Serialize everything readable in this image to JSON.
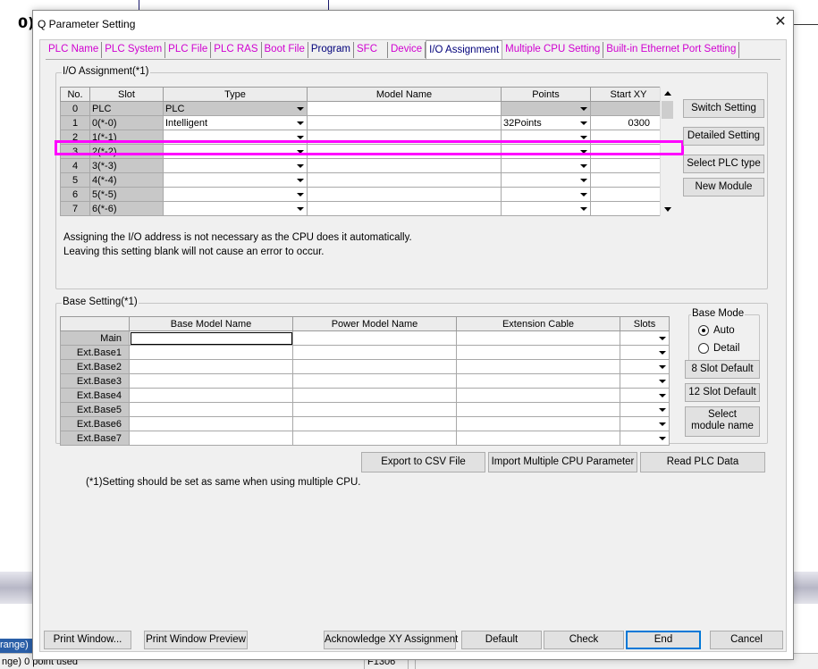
{
  "background": {
    "fragment_left": "0)",
    "blue_tab_text": "range)",
    "status_left": "nge) 0 point used",
    "status_mid": "F1306"
  },
  "dialog": {
    "title": "Q Parameter Setting",
    "close_glyph": "✕"
  },
  "tabs": [
    {
      "label": "PLC Name"
    },
    {
      "label": "PLC System"
    },
    {
      "label": "PLC File"
    },
    {
      "label": "PLC RAS"
    },
    {
      "label": "Boot File"
    },
    {
      "label": "Program"
    },
    {
      "label": "SFC"
    },
    {
      "label": "Device"
    },
    {
      "label": "I/O Assignment"
    },
    {
      "label": "Multiple CPU Setting"
    },
    {
      "label": "Built-in Ethernet Port Setting"
    }
  ],
  "io": {
    "group_label": "I/O Assignment(*1)",
    "columns": [
      "No.",
      "Slot",
      "Type",
      "Model Name",
      "Points",
      "Start XY"
    ],
    "rows": [
      {
        "no": "0",
        "slot": "PLC",
        "type": "PLC",
        "model": "",
        "points": "",
        "start": ""
      },
      {
        "no": "1",
        "slot": "0(*-0)",
        "type": "Intelligent",
        "model": "",
        "points": "32Points",
        "start": "0300"
      },
      {
        "no": "2",
        "slot": "1(*-1)",
        "type": "",
        "model": "",
        "points": "",
        "start": ""
      },
      {
        "no": "3",
        "slot": "2(*-2)",
        "type": "",
        "model": "",
        "points": "",
        "start": ""
      },
      {
        "no": "4",
        "slot": "3(*-3)",
        "type": "",
        "model": "",
        "points": "",
        "start": ""
      },
      {
        "no": "5",
        "slot": "4(*-4)",
        "type": "",
        "model": "",
        "points": "",
        "start": ""
      },
      {
        "no": "6",
        "slot": "5(*-5)",
        "type": "",
        "model": "",
        "points": "",
        "start": ""
      },
      {
        "no": "7",
        "slot": "6(*-6)",
        "type": "",
        "model": "",
        "points": "",
        "start": ""
      }
    ],
    "note1": "Assigning the I/O address is not necessary as the CPU does it automatically.",
    "note2": "Leaving this setting blank will not cause an error to occur.",
    "buttons": {
      "switch": "Switch Setting",
      "detailed": "Detailed Setting",
      "select_plc": "Select PLC type",
      "new_module": "New Module"
    }
  },
  "base": {
    "group_label": "Base Setting(*1)",
    "columns": [
      "",
      "Base Model Name",
      "Power Model Name",
      "Extension Cable",
      "Slots"
    ],
    "rows": [
      {
        "name": "Main"
      },
      {
        "name": "Ext.Base1"
      },
      {
        "name": "Ext.Base2"
      },
      {
        "name": "Ext.Base3"
      },
      {
        "name": "Ext.Base4"
      },
      {
        "name": "Ext.Base5"
      },
      {
        "name": "Ext.Base6"
      },
      {
        "name": "Ext.Base7"
      }
    ],
    "mode_label": "Base Mode",
    "mode_auto": "Auto",
    "mode_detail": "Detail",
    "buttons": {
      "eight_slot": "8 Slot Default",
      "twelve_slot": "12 Slot Default",
      "select_module_1": "Select",
      "select_module_2": "module name"
    }
  },
  "actions": {
    "export_csv": "Export to CSV File",
    "import_multi": "Import Multiple CPU Parameter",
    "read_plc": "Read PLC Data"
  },
  "footnote": "(*1)Setting should be set as same when using multiple CPU.",
  "bottom": {
    "print_window": "Print Window...",
    "print_preview": "Print Window Preview",
    "ack_xy": "Acknowledge XY Assignment",
    "default": "Default",
    "check": "Check",
    "end": "End",
    "cancel": "Cancel"
  }
}
